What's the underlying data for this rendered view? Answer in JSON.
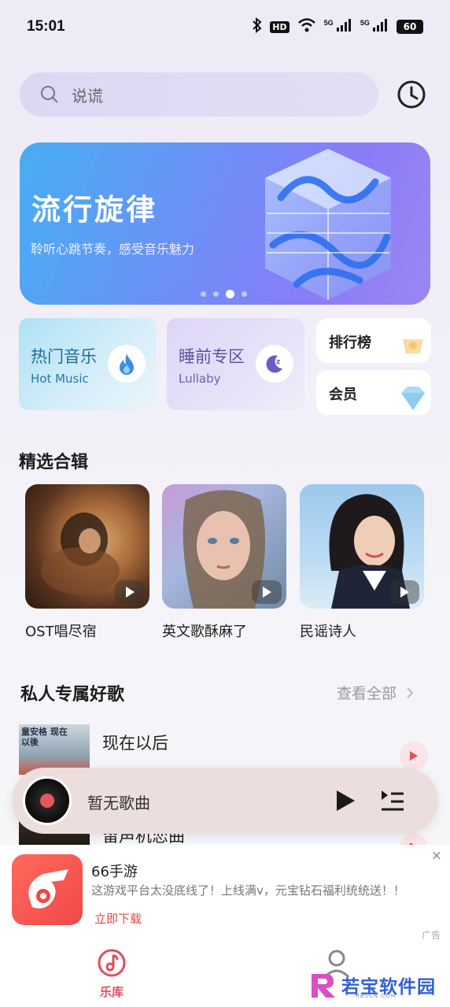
{
  "status_bar": {
    "time": "15:01",
    "hd": "HD",
    "net1": "5G",
    "net2": "5G",
    "battery": "60"
  },
  "search": {
    "placeholder": "说谎"
  },
  "banner": {
    "title": "流行旋律",
    "subtitle": "聆听心跳节奏，感受音乐魅力",
    "dots_total": 4,
    "active_dot": 2
  },
  "categories": {
    "hot": {
      "title": "热门音乐",
      "en": "Hot Music"
    },
    "sleep": {
      "title": "睡前专区",
      "en": "Lullaby"
    },
    "chart": {
      "label": "排行榜"
    },
    "vip": {
      "label": "会员"
    }
  },
  "featured": {
    "title": "精选合辑",
    "albums": [
      {
        "name": "OST唱尽宿"
      },
      {
        "name": "英文歌酥麻了"
      },
      {
        "name": "民谣诗人"
      }
    ]
  },
  "private": {
    "title": "私人专属好歌",
    "view_all": "查看全部",
    "songs": [
      {
        "title": "现在以后",
        "thumb_text": "童安格 现在以後"
      },
      {
        "title": "留声机恋曲"
      }
    ]
  },
  "player": {
    "title": "暂无歌曲"
  },
  "ad": {
    "name": "66手游",
    "desc": "这游戏平台太没底线了！上线满v，元宝钻石福利统统送！！",
    "cta": "立即下载",
    "tag": "广告",
    "close": "×"
  },
  "tabbar": {
    "library": "乐库"
  },
  "watermark": {
    "text": "若宝软件园",
    "sub": "RBSCN.COM"
  },
  "colors": {
    "accent": "#e24d5b",
    "banner_start": "#47aef3",
    "banner_end": "#9c86f3"
  }
}
